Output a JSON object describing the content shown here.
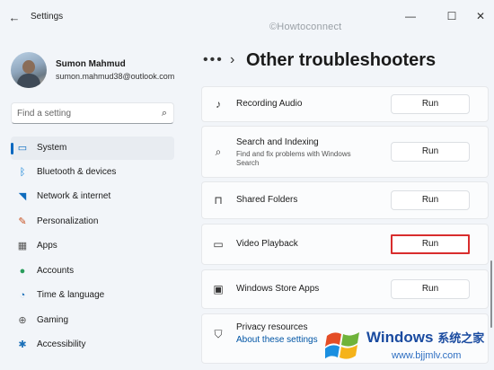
{
  "window": {
    "title": "Settings",
    "watermark": "©Howtoconnect",
    "minimize_glyph": "—",
    "maximize_glyph": "☐",
    "close_glyph": "✕"
  },
  "profile": {
    "name": "Sumon Mahmud",
    "email": "sumon.mahmud38@outlook.com"
  },
  "search": {
    "placeholder": "Find a setting",
    "icon": "search-icon"
  },
  "sidebar": {
    "items": [
      {
        "label": "System",
        "icon": "system-icon",
        "glyph": "▭",
        "color": "#0067c0",
        "active": true
      },
      {
        "label": "Bluetooth & devices",
        "icon": "bluetooth-icon",
        "glyph": "ᛒ",
        "color": "#0078d4"
      },
      {
        "label": "Network & internet",
        "icon": "wifi-icon",
        "glyph": "◥",
        "color": "#0f6cbd"
      },
      {
        "label": "Personalization",
        "icon": "paintbrush-icon",
        "glyph": "✎",
        "color": "#c8501f"
      },
      {
        "label": "Apps",
        "icon": "apps-icon",
        "glyph": "▦",
        "color": "#555555"
      },
      {
        "label": "Accounts",
        "icon": "person-icon",
        "glyph": "●",
        "color": "#2a9d5c"
      },
      {
        "label": "Time & language",
        "icon": "globe-clock-icon",
        "glyph": "◔",
        "color": "#1b6fb8"
      },
      {
        "label": "Gaming",
        "icon": "gamepad-icon",
        "glyph": "⊕",
        "color": "#555555"
      },
      {
        "label": "Accessibility",
        "icon": "accessibility-icon",
        "glyph": "✱",
        "color": "#1b6fb8"
      }
    ]
  },
  "breadcrumb": {
    "more": "•••",
    "chevron": "›",
    "title": "Other troubleshooters"
  },
  "troubleshooters": [
    {
      "title": "Recording Audio",
      "description": "",
      "icon": "microphone-icon",
      "glyph": "♪",
      "button": "Run"
    },
    {
      "title": "Search and Indexing",
      "description": "Find and fix problems with Windows Search",
      "icon": "search-icon",
      "glyph": "⌕",
      "button": "Run"
    },
    {
      "title": "Shared Folders",
      "description": "",
      "icon": "shared-folder-icon",
      "glyph": "⊓",
      "button": "Run"
    },
    {
      "title": "Video Playback",
      "description": "",
      "icon": "video-camera-icon",
      "glyph": "▭",
      "button": "Run",
      "highlighted": true
    },
    {
      "title": "Windows Store Apps",
      "description": "",
      "icon": "store-app-icon",
      "glyph": "▣",
      "button": "Run"
    }
  ],
  "privacy": {
    "title": "Privacy resources",
    "link": "About these settings",
    "icon": "shield-icon",
    "glyph": "⛉"
  },
  "brand": {
    "name": "Windows",
    "cn": "系统之家",
    "url": "www.bjjmlv.com"
  },
  "colors": {
    "accent": "#0067c0",
    "highlight": "#d82d2d",
    "background": "#f2f5f9"
  }
}
